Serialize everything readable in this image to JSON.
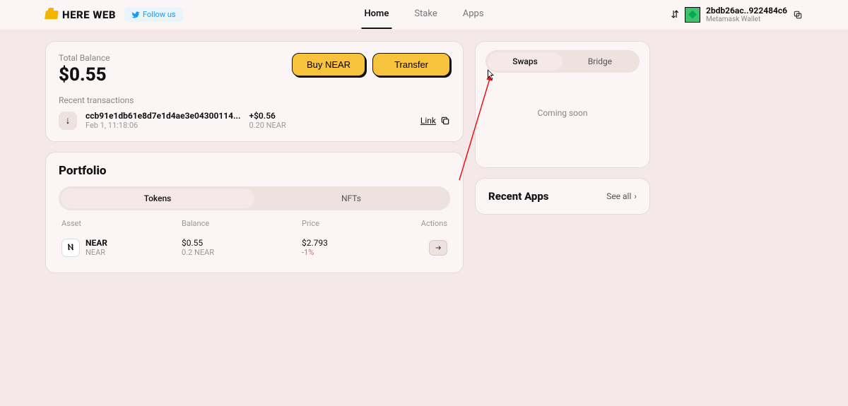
{
  "brand": {
    "name": "HERE WEB",
    "follow_label": "Follow us"
  },
  "nav": {
    "home": "Home",
    "stake": "Stake",
    "apps": "Apps"
  },
  "wallet": {
    "address": "2bdb26ac..922484c6",
    "provider": "Metamask Wallet"
  },
  "balance": {
    "label": "Total Balance",
    "value": "$0.55",
    "buy_label": "Buy NEAR",
    "transfer_label": "Transfer",
    "recent_label": "Recent transactions",
    "txn": {
      "hash": "ccb91e1db61e8d7e1d4ae3e04300114...",
      "date": "Feb 1, 11:18:06",
      "amount_usd": "+$0.56",
      "amount_native": "0.20 NEAR",
      "link_label": "Link"
    }
  },
  "portfolio": {
    "title": "Portfolio",
    "tab_tokens": "Tokens",
    "tab_nfts": "NFTs",
    "col_asset": "Asset",
    "col_balance": "Balance",
    "col_price": "Price",
    "col_actions": "Actions",
    "rows": [
      {
        "symbol": "NEAR",
        "name": "NEAR",
        "bal_usd": "$0.55",
        "bal_native": "0.2 NEAR",
        "price": "$2.793",
        "change": "-1%"
      }
    ]
  },
  "swaps": {
    "tab_swaps": "Swaps",
    "tab_bridge": "Bridge",
    "coming": "Coming soon"
  },
  "recent_apps": {
    "title": "Recent Apps",
    "see_all": "See all"
  }
}
